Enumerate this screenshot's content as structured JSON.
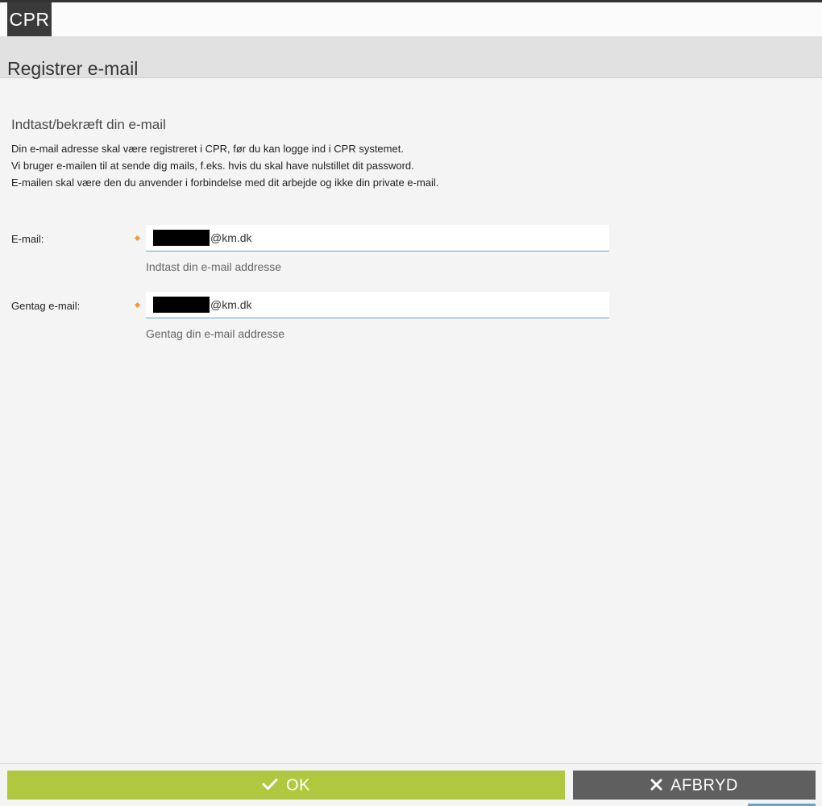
{
  "header": {
    "logo_text": "CPR",
    "page_title": "Registrer e-mail"
  },
  "section": {
    "title": "Indtast/bekræft din e-mail",
    "intro": [
      "Din e-mail adresse skal være registreret i CPR, før du kan logge ind i CPR systemet.",
      "Vi bruger e-mailen til at sende dig mails, f.eks. hvis du skal have nulstillet dit password.",
      "E-mailen skal være den du anvender i forbindelse med dit arbejde og ikke din private e-mail."
    ]
  },
  "form": {
    "email": {
      "label": "E-mail:",
      "value_visible": "@km.dk",
      "hint": "Indtast din e-mail addresse"
    },
    "repeat_email": {
      "label": "Gentag e-mail:",
      "value_visible": "@km.dk",
      "hint": "Gentag din e-mail addresse"
    }
  },
  "footer": {
    "ok_label": "OK",
    "cancel_label": "AFBRYD"
  },
  "colors": {
    "ok_button": "#b0c840",
    "cancel_button": "#5f5f5f",
    "required_marker": "#f39a2a",
    "field_underline": "#6aa3c4"
  },
  "icons": {
    "ok": "check-icon",
    "cancel": "close-icon",
    "required": "required-diamond-icon"
  }
}
